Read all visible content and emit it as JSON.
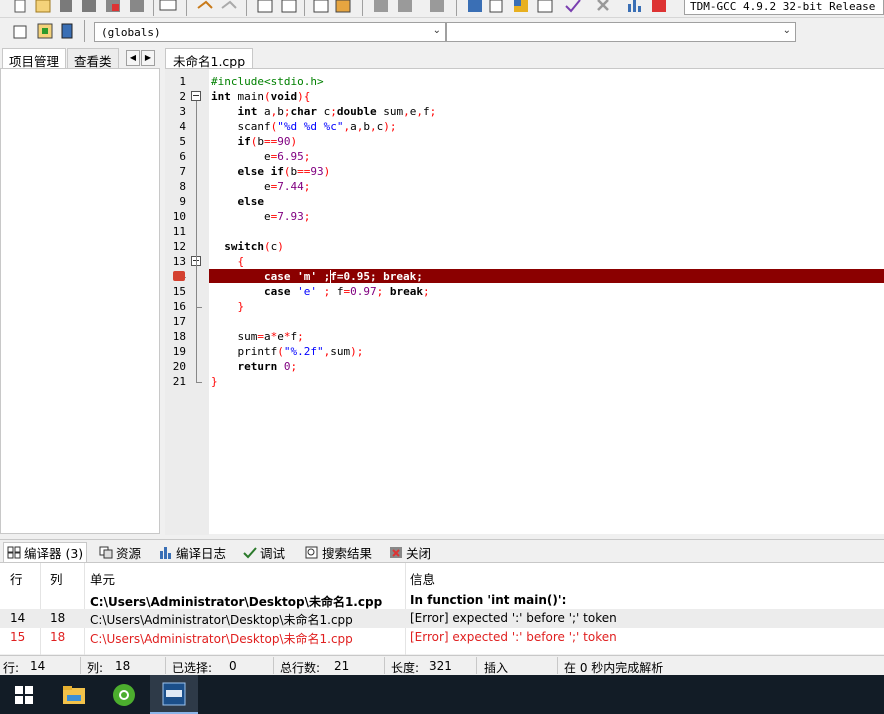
{
  "toolbar": {
    "compiler_label": "TDM-GCC 4.9.2 32-bit Release"
  },
  "toolbar2": {
    "scope_combo": "(globals)",
    "symbol_combo": ""
  },
  "left_panel": {
    "tabs": [
      "项目管理",
      "查看类"
    ]
  },
  "editor": {
    "tab_label": "未命名1.cpp",
    "error_line": 14,
    "lines": [
      {
        "n": "1",
        "segs": [
          [
            "pp",
            "#include<stdio.h>"
          ]
        ]
      },
      {
        "n": "2",
        "segs": [
          [
            "kw",
            "int"
          ],
          [
            "txt",
            " main"
          ],
          [
            "sym",
            "("
          ],
          [
            "kw",
            "void"
          ],
          [
            "sym",
            ")"
          ],
          [
            "sym",
            "{"
          ]
        ]
      },
      {
        "n": "3",
        "segs": [
          [
            "txt",
            "    "
          ],
          [
            "kw",
            "int"
          ],
          [
            "txt",
            " a"
          ],
          [
            "sym",
            ","
          ],
          [
            "txt",
            "b"
          ],
          [
            "sym",
            ";"
          ],
          [
            "kw",
            "char"
          ],
          [
            "txt",
            " c"
          ],
          [
            "sym",
            ";"
          ],
          [
            "kw",
            "double"
          ],
          [
            "txt",
            " sum"
          ],
          [
            "sym",
            ","
          ],
          [
            "txt",
            "e"
          ],
          [
            "sym",
            ","
          ],
          [
            "txt",
            "f"
          ],
          [
            "sym",
            ";"
          ]
        ]
      },
      {
        "n": "4",
        "segs": [
          [
            "txt",
            "    scanf"
          ],
          [
            "sym",
            "("
          ],
          [
            "str",
            "\"%d %d %c\""
          ],
          [
            "sym",
            ","
          ],
          [
            "txt",
            "a"
          ],
          [
            "sym",
            ","
          ],
          [
            "txt",
            "b"
          ],
          [
            "sym",
            ","
          ],
          [
            "txt",
            "c"
          ],
          [
            "sym",
            ")"
          ],
          [
            "sym",
            ";"
          ]
        ]
      },
      {
        "n": "5",
        "segs": [
          [
            "txt",
            "    "
          ],
          [
            "kw",
            "if"
          ],
          [
            "sym",
            "("
          ],
          [
            "txt",
            "b"
          ],
          [
            "sym",
            "=="
          ],
          [
            "num",
            "90"
          ],
          [
            "sym",
            ")"
          ]
        ]
      },
      {
        "n": "6",
        "segs": [
          [
            "txt",
            "        e"
          ],
          [
            "sym",
            "="
          ],
          [
            "num",
            "6.95"
          ],
          [
            "sym",
            ";"
          ]
        ]
      },
      {
        "n": "7",
        "segs": [
          [
            "txt",
            "    "
          ],
          [
            "kw",
            "else if"
          ],
          [
            "sym",
            "("
          ],
          [
            "txt",
            "b"
          ],
          [
            "sym",
            "=="
          ],
          [
            "num",
            "93"
          ],
          [
            "sym",
            ")"
          ]
        ]
      },
      {
        "n": "8",
        "segs": [
          [
            "txt",
            "        e"
          ],
          [
            "sym",
            "="
          ],
          [
            "num",
            "7.44"
          ],
          [
            "sym",
            ";"
          ]
        ]
      },
      {
        "n": "9",
        "segs": [
          [
            "txt",
            "    "
          ],
          [
            "kw",
            "else"
          ]
        ]
      },
      {
        "n": "10",
        "segs": [
          [
            "txt",
            "        e"
          ],
          [
            "sym",
            "="
          ],
          [
            "num",
            "7.93"
          ],
          [
            "sym",
            ";"
          ]
        ]
      },
      {
        "n": "11",
        "segs": []
      },
      {
        "n": "12",
        "segs": [
          [
            "txt",
            "  "
          ],
          [
            "kw",
            "switch"
          ],
          [
            "sym",
            "("
          ],
          [
            "txt",
            "c"
          ],
          [
            "sym",
            ")"
          ]
        ]
      },
      {
        "n": "13",
        "segs": [
          [
            "txt",
            "    "
          ],
          [
            "sym",
            "{"
          ]
        ]
      },
      {
        "n": "14",
        "segs": [
          [
            "errtxt",
            "        case 'm' ;f=0.95; break;"
          ]
        ]
      },
      {
        "n": "15",
        "segs": [
          [
            "txt",
            "        "
          ],
          [
            "kw",
            "case"
          ],
          [
            "txt",
            " "
          ],
          [
            "str",
            "'e'"
          ],
          [
            "txt",
            " "
          ],
          [
            "sym",
            ";"
          ],
          [
            "txt",
            " f"
          ],
          [
            "sym",
            "="
          ],
          [
            "num",
            "0.97"
          ],
          [
            "sym",
            ";"
          ],
          [
            "txt",
            " "
          ],
          [
            "kw",
            "break"
          ],
          [
            "sym",
            ";"
          ]
        ]
      },
      {
        "n": "16",
        "segs": [
          [
            "txt",
            "    "
          ],
          [
            "sym",
            "}"
          ]
        ]
      },
      {
        "n": "17",
        "segs": []
      },
      {
        "n": "18",
        "segs": [
          [
            "txt",
            "    sum"
          ],
          [
            "sym",
            "="
          ],
          [
            "txt",
            "a"
          ],
          [
            "sym",
            "*"
          ],
          [
            "txt",
            "e"
          ],
          [
            "sym",
            "*"
          ],
          [
            "txt",
            "f"
          ],
          [
            "sym",
            ";"
          ]
        ]
      },
      {
        "n": "19",
        "segs": [
          [
            "txt",
            "    printf"
          ],
          [
            "sym",
            "("
          ],
          [
            "str",
            "\"%.2f\""
          ],
          [
            "sym",
            ","
          ],
          [
            "txt",
            "sum"
          ],
          [
            "sym",
            ")"
          ],
          [
            "sym",
            ";"
          ]
        ]
      },
      {
        "n": "20",
        "segs": [
          [
            "txt",
            "    "
          ],
          [
            "kw",
            "return"
          ],
          [
            "txt",
            " "
          ],
          [
            "num",
            "0"
          ],
          [
            "sym",
            ";"
          ]
        ]
      },
      {
        "n": "21",
        "segs": [
          [
            "sym",
            "}"
          ]
        ]
      }
    ]
  },
  "bottom_tabs": {
    "compiler": "编译器 (3)",
    "resources": "资源",
    "compile_log": "编译日志",
    "debug": "调试",
    "search_results": "搜索结果",
    "close": "关闭"
  },
  "messages": {
    "headers": {
      "line": "行",
      "col": "列",
      "unit": "单元",
      "info": "信息"
    },
    "rows": [
      {
        "line": "",
        "col": "",
        "unit": "C:\\Users\\Administrator\\Desktop\\未命名1.cpp",
        "info": "In function 'int main()':"
      },
      {
        "line": "14",
        "col": "18",
        "unit": "C:\\Users\\Administrator\\Desktop\\未命名1.cpp",
        "info": "[Error] expected ':' before ';' token"
      },
      {
        "line": "15",
        "col": "18",
        "unit": "C:\\Users\\Administrator\\Desktop\\未命名1.cpp",
        "info": "[Error] expected ':' before ';' token"
      }
    ]
  },
  "status": {
    "row_label": "行:",
    "row_value": "14",
    "col_label": "列:",
    "col_value": "18",
    "sel_label": "已选择:",
    "sel_value": "0",
    "total_label": "总行数:",
    "total_value": "21",
    "len_label": "长度:",
    "len_value": "321",
    "mode": "插入",
    "parse": "在 0 秒内完成解析"
  },
  "colors": {
    "error_line_bg": "#8b0000",
    "error_text": "#e02020",
    "keyword": "#000000",
    "preprocessor": "#008000",
    "string": "#0000ff",
    "number": "#800080",
    "symbol": "#ff0000"
  },
  "taskbar": {
    "items": [
      "windows-start-icon",
      "file-explorer-icon",
      "browser-icon",
      "dev-cpp-icon"
    ]
  }
}
